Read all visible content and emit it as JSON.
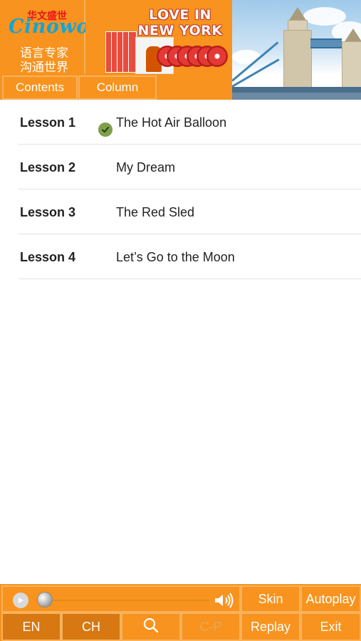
{
  "header": {
    "logo": {
      "cn_brand": "华文盛世",
      "word": "Cinowo",
      "slogan_line1": "语言专家",
      "slogan_line2": "沟通世界"
    },
    "banner": {
      "title_line1": "LOVE IN",
      "title_line2": "NEW YORK",
      "book_cover_text": "LOVE IN NEW YORK"
    },
    "photo_subject": "tower-bridge",
    "tabs": [
      {
        "label": "Contents"
      },
      {
        "label": "Column"
      }
    ]
  },
  "lessons": [
    {
      "number": "Lesson 1",
      "title": "The Hot Air Balloon",
      "completed": true
    },
    {
      "number": "Lesson 2",
      "title": "My Dream",
      "completed": false
    },
    {
      "number": "Lesson 3",
      "title": "The Red Sled",
      "completed": false
    },
    {
      "number": "Lesson 4",
      "title": "Let’s Go to the Moon",
      "completed": false
    }
  ],
  "player": {
    "progress": 0.0,
    "play_icon": "play-icon",
    "volume_icon": "speaker-icon"
  },
  "bottom_bar": {
    "skin": "Skin",
    "autoplay": "Autoplay",
    "en": "EN",
    "ch": "CH",
    "search_icon": "search-icon",
    "cp": "C-P",
    "replay": "Replay",
    "exit": "Exit"
  },
  "colors": {
    "accent": "#f7931e",
    "accent_dark": "#d77812",
    "border": "#f9b25a",
    "check": "#7ea04a",
    "logo_blue": "#13a4d6",
    "logo_red": "#e8141a"
  }
}
